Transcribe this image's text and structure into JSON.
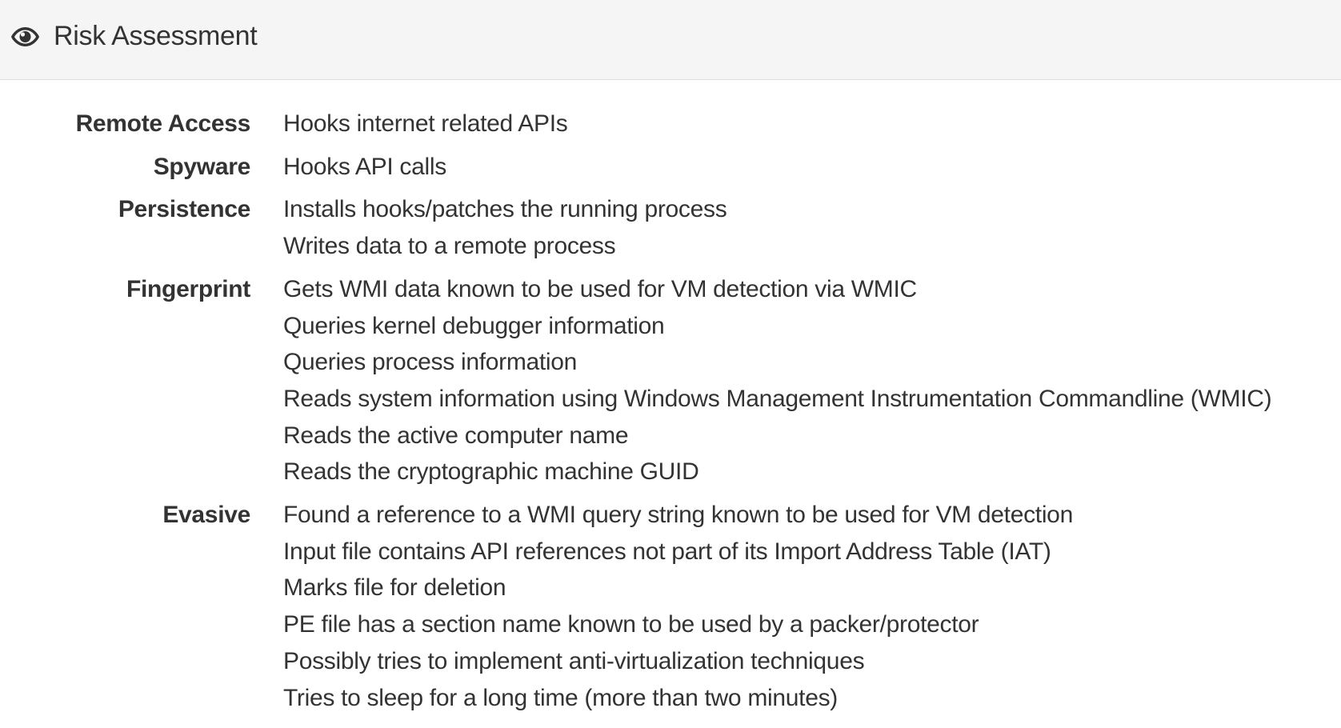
{
  "header": {
    "title": "Risk Assessment",
    "icon": "eye-icon"
  },
  "risks": [
    {
      "category": "Remote Access",
      "items": [
        "Hooks internet related APIs"
      ]
    },
    {
      "category": "Spyware",
      "items": [
        "Hooks API calls"
      ]
    },
    {
      "category": "Persistence",
      "items": [
        "Installs hooks/patches the running process",
        "Writes data to a remote process"
      ]
    },
    {
      "category": "Fingerprint",
      "items": [
        "Gets WMI data known to be used for VM detection via WMIC",
        "Queries kernel debugger information",
        "Queries process information",
        "Reads system information using Windows Management Instrumentation Commandline (WMIC)",
        "Reads the active computer name",
        "Reads the cryptographic machine GUID"
      ]
    },
    {
      "category": "Evasive",
      "items": [
        "Found a reference to a WMI query string known to be used for VM detection",
        "Input file contains API references not part of its Import Address Table (IAT)",
        "Marks file for deletion",
        "PE file has a section name known to be used by a packer/protector",
        "Possibly tries to implement anti-virtualization techniques",
        "Tries to sleep for a long time (more than two minutes)"
      ]
    }
  ]
}
